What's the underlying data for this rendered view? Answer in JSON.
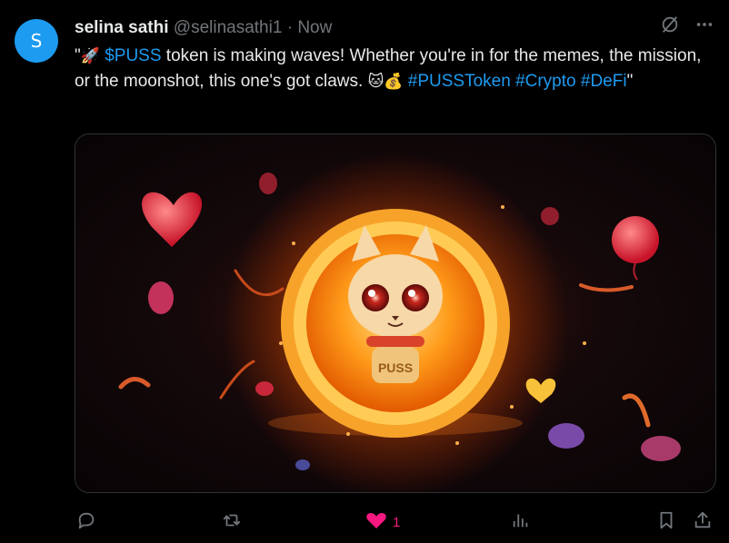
{
  "post": {
    "avatar_letter": "S",
    "display_name": "selina sathi",
    "handle": "@selinasathi1",
    "separator": "·",
    "time": "Now",
    "text": {
      "open_quote": "\"",
      "rocket_emoji": "🚀",
      "cashtag": "$PUSS",
      "body": " token is making waves! Whether you're in for the memes, the mission, or the moonshot, this one's got claws. ",
      "cat_emoji": "🐱",
      "money_emoji": "💰",
      "hashtag_1": "#PUSSToken",
      "hashtag_2": "#Crypto",
      "hashtag_3": "#DeFi",
      "close_quote": "\""
    },
    "media": {
      "coin_text": "PUSS"
    }
  },
  "actions": {
    "like_count": "1"
  },
  "colors": {
    "background": "#000000",
    "link": "#1d9bf0",
    "like": "#f91880",
    "muted": "#71767b",
    "avatar": "#1d9bf0"
  },
  "icons": [
    "grok-icon",
    "more-icon",
    "reply-icon",
    "retweet-icon",
    "heart-icon",
    "analytics-icon",
    "bookmark-icon",
    "share-icon"
  ]
}
